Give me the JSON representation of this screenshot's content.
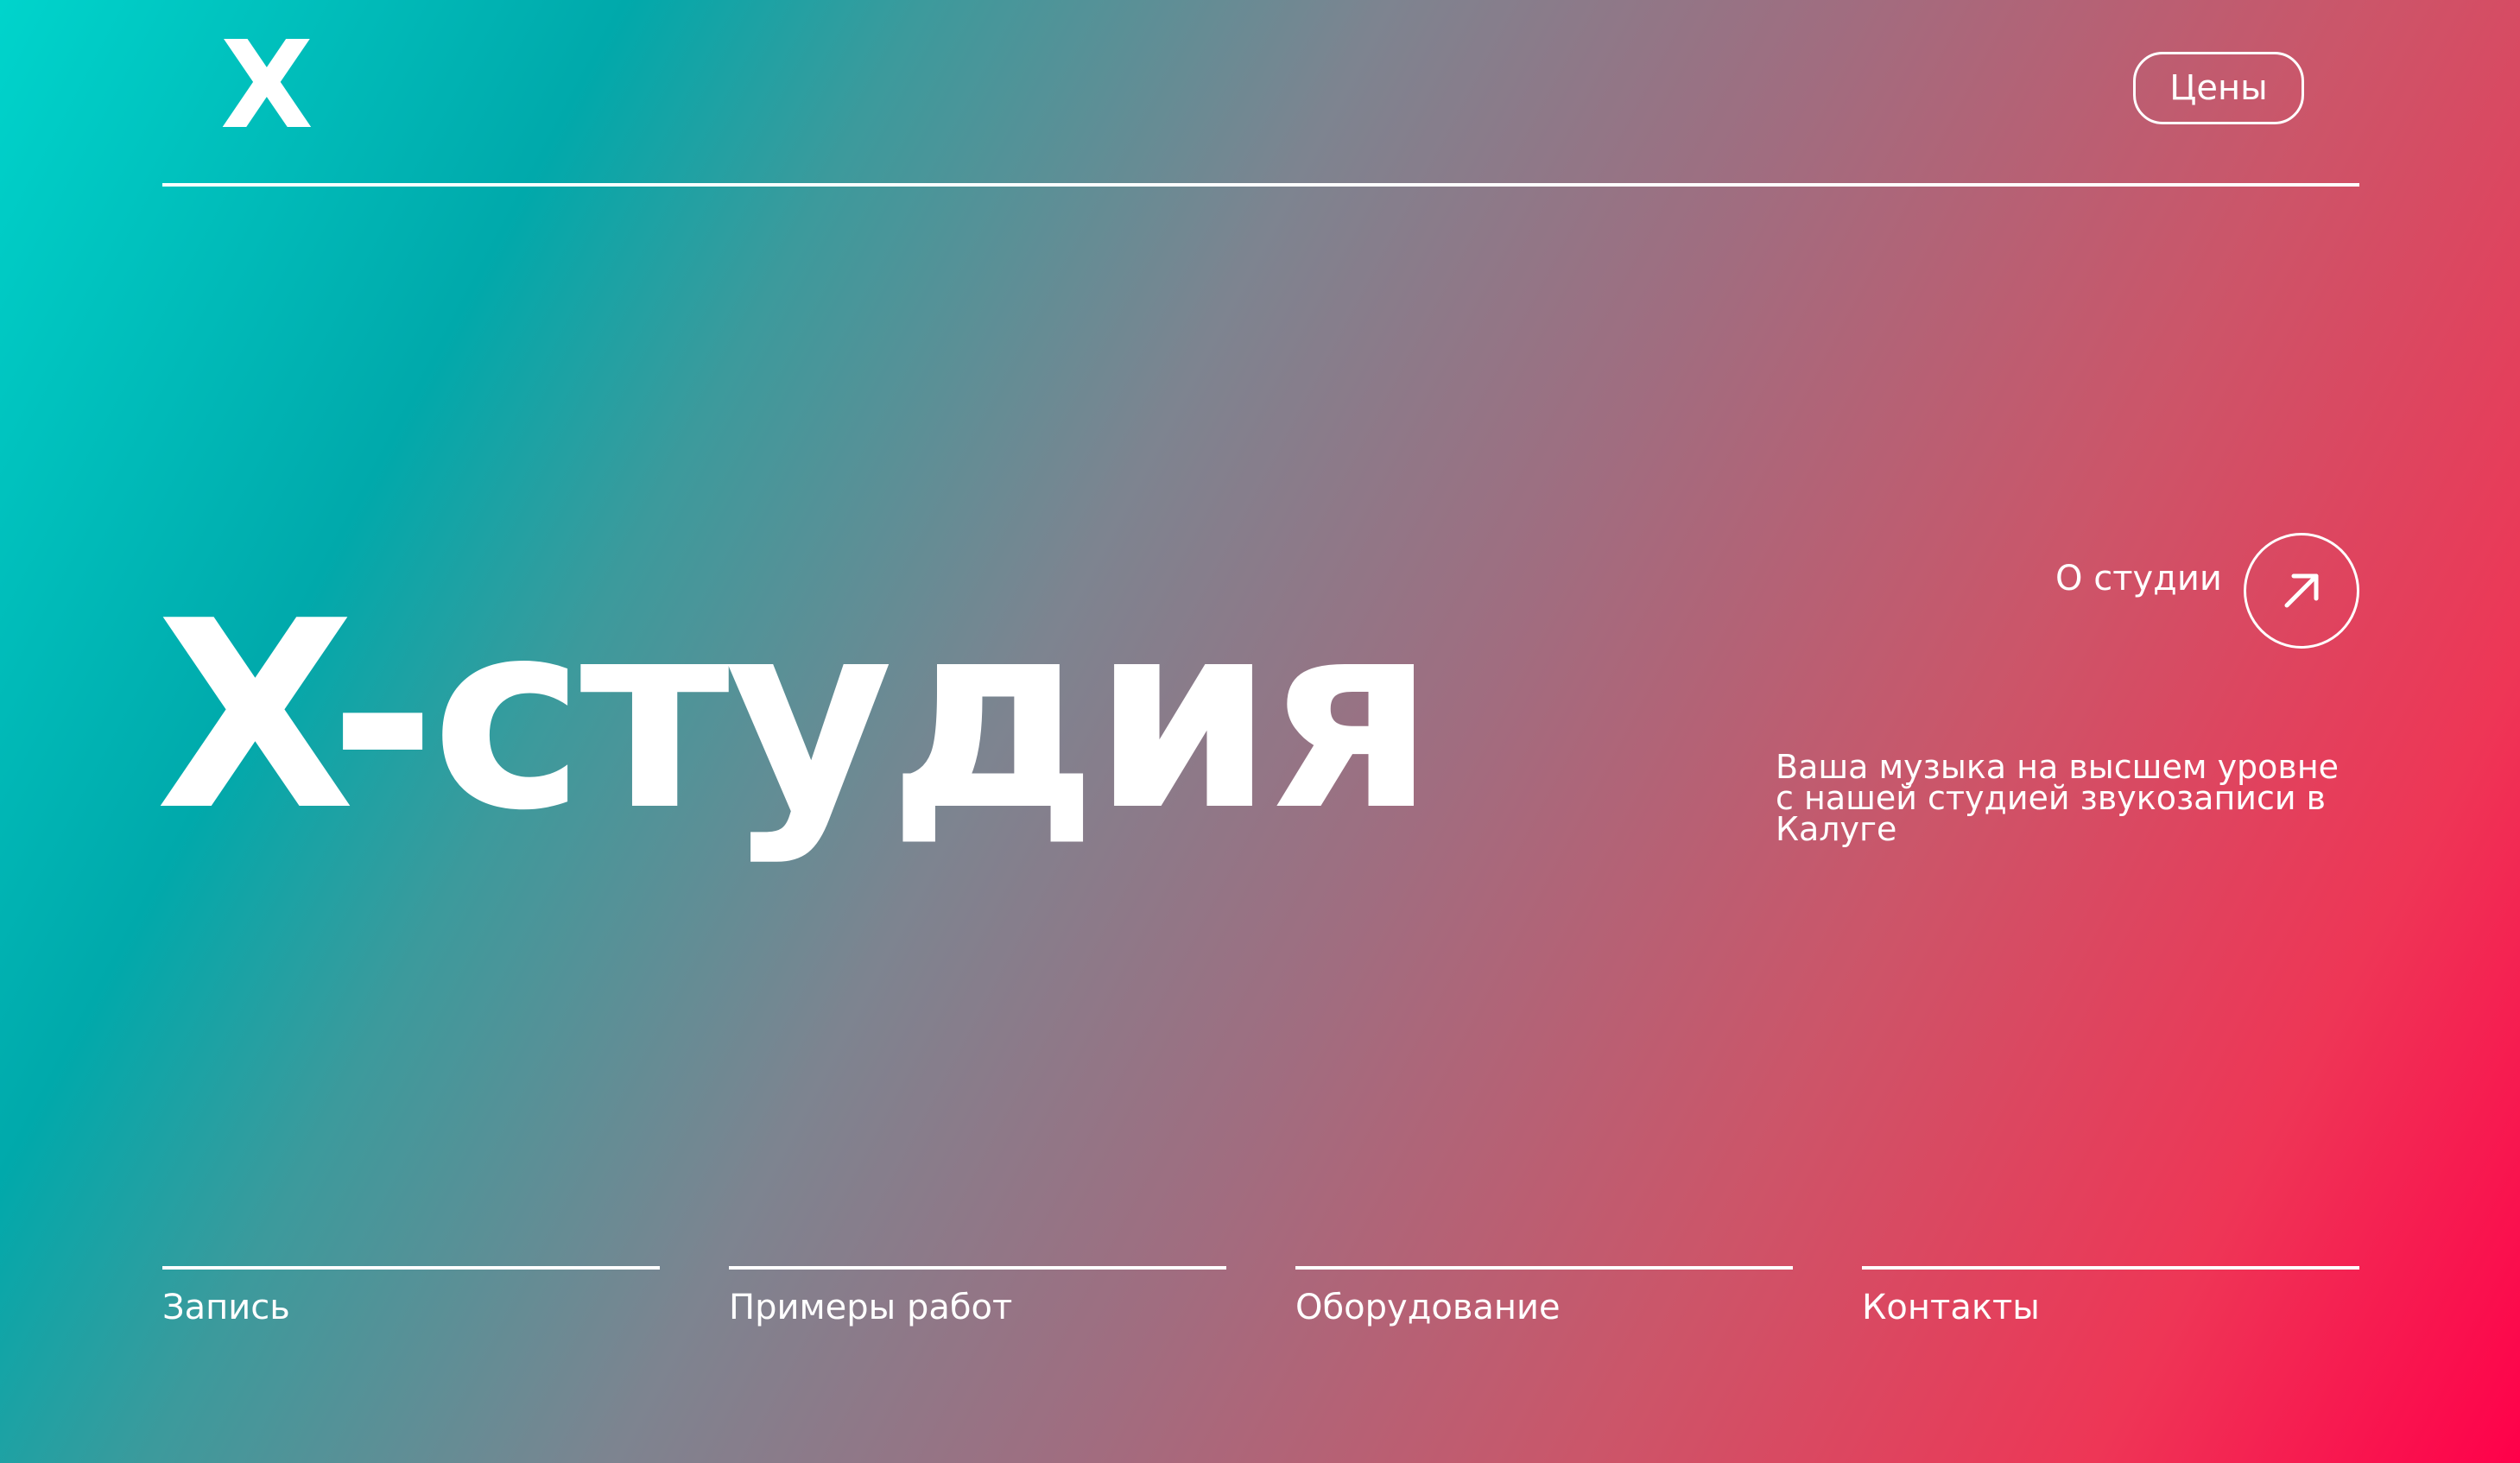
{
  "header": {
    "logo": "X",
    "price_button": "Цены"
  },
  "hero": {
    "title": "X-студия",
    "about_label": "О студии",
    "about_icon": "arrow-up-right-icon",
    "tagline": "Ваша музыка на высшем уровне с нашей студией звукозаписи в Калуге"
  },
  "nav": {
    "items": [
      {
        "label": "Запись"
      },
      {
        "label": "Примеры работ"
      },
      {
        "label": "Оборудование"
      },
      {
        "label": "Контакты"
      }
    ]
  },
  "colors": {
    "gradient_start": "#00d4cc",
    "gradient_mid": "#7d8490",
    "gradient_end": "#ff004a",
    "text": "#ffffff"
  }
}
